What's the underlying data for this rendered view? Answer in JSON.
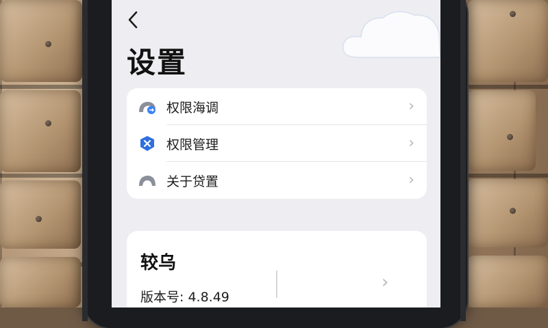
{
  "screen": {
    "back_icon": "chevron-left-icon",
    "title": "设置"
  },
  "settings_group": {
    "items": [
      {
        "label": "权限海调",
        "icon": "helmet-share-icon"
      },
      {
        "label": "权限管理",
        "icon": "shield-x-icon"
      },
      {
        "label": "关于贷置",
        "icon": "helmet-icon"
      }
    ]
  },
  "about_card": {
    "app_name": "较乌",
    "version": "版本号: 4.8.49"
  },
  "colors": {
    "accent_blue": "#3b82f6",
    "background": "#eeeef2",
    "card": "#ffffff"
  }
}
